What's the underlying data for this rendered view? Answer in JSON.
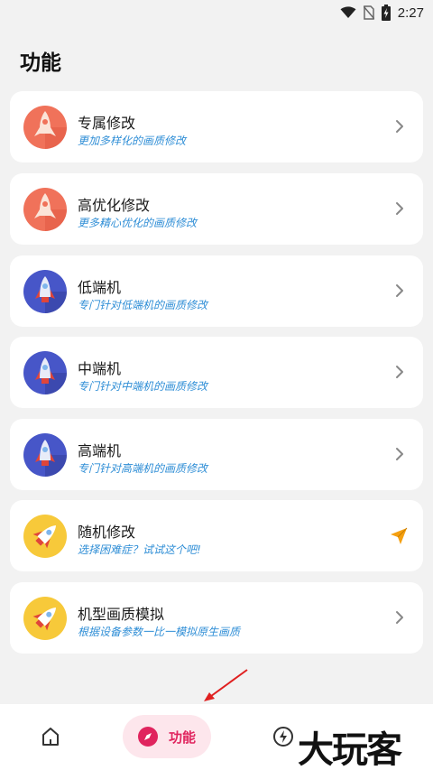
{
  "status_bar": {
    "time": "2:27",
    "icons": [
      "wifi-icon",
      "no-sim-icon",
      "battery-charging-icon"
    ]
  },
  "page": {
    "title": "功能"
  },
  "cards": [
    {
      "title": "专属修改",
      "subtitle": "更加多样化的画质修改",
      "icon": "rocket-red-icon",
      "action_icon": "chevron-right-icon"
    },
    {
      "title": "高优化修改",
      "subtitle": "更多精心优化的画质修改",
      "icon": "rocket-red-icon",
      "action_icon": "chevron-right-icon"
    },
    {
      "title": "低端机",
      "subtitle": "专门针对低端机的画质修改",
      "icon": "rocket-blue-icon",
      "action_icon": "chevron-right-icon"
    },
    {
      "title": "中端机",
      "subtitle": "专门针对中端机的画质修改",
      "icon": "rocket-blue-icon",
      "action_icon": "chevron-right-icon"
    },
    {
      "title": "高端机",
      "subtitle": "专门针对高端机的画质修改",
      "icon": "rocket-blue-icon",
      "action_icon": "chevron-right-icon"
    },
    {
      "title": "随机修改",
      "subtitle": "选择困难症？试试这个吧!",
      "icon": "rocket-yellow-icon",
      "action_icon": "send-icon"
    },
    {
      "title": "机型画质模拟",
      "subtitle": "根据设备参数一比一模拟原生画质",
      "icon": "rocket-yellow-icon",
      "action_icon": "chevron-right-icon"
    }
  ],
  "bottom_nav": {
    "items": [
      {
        "icon": "home-icon",
        "label": ""
      },
      {
        "icon": "compass-icon",
        "label": "功能",
        "active": true
      },
      {
        "icon": "bolt-icon",
        "label": ""
      }
    ]
  },
  "watermark": "大玩客",
  "colors": {
    "background": "#f2f2f2",
    "card": "#ffffff",
    "subtitle": "#2f8ed6",
    "active_nav_bg": "#fde6ec",
    "active_nav_text": "#e0245e",
    "send_icon": "#f5a010"
  }
}
